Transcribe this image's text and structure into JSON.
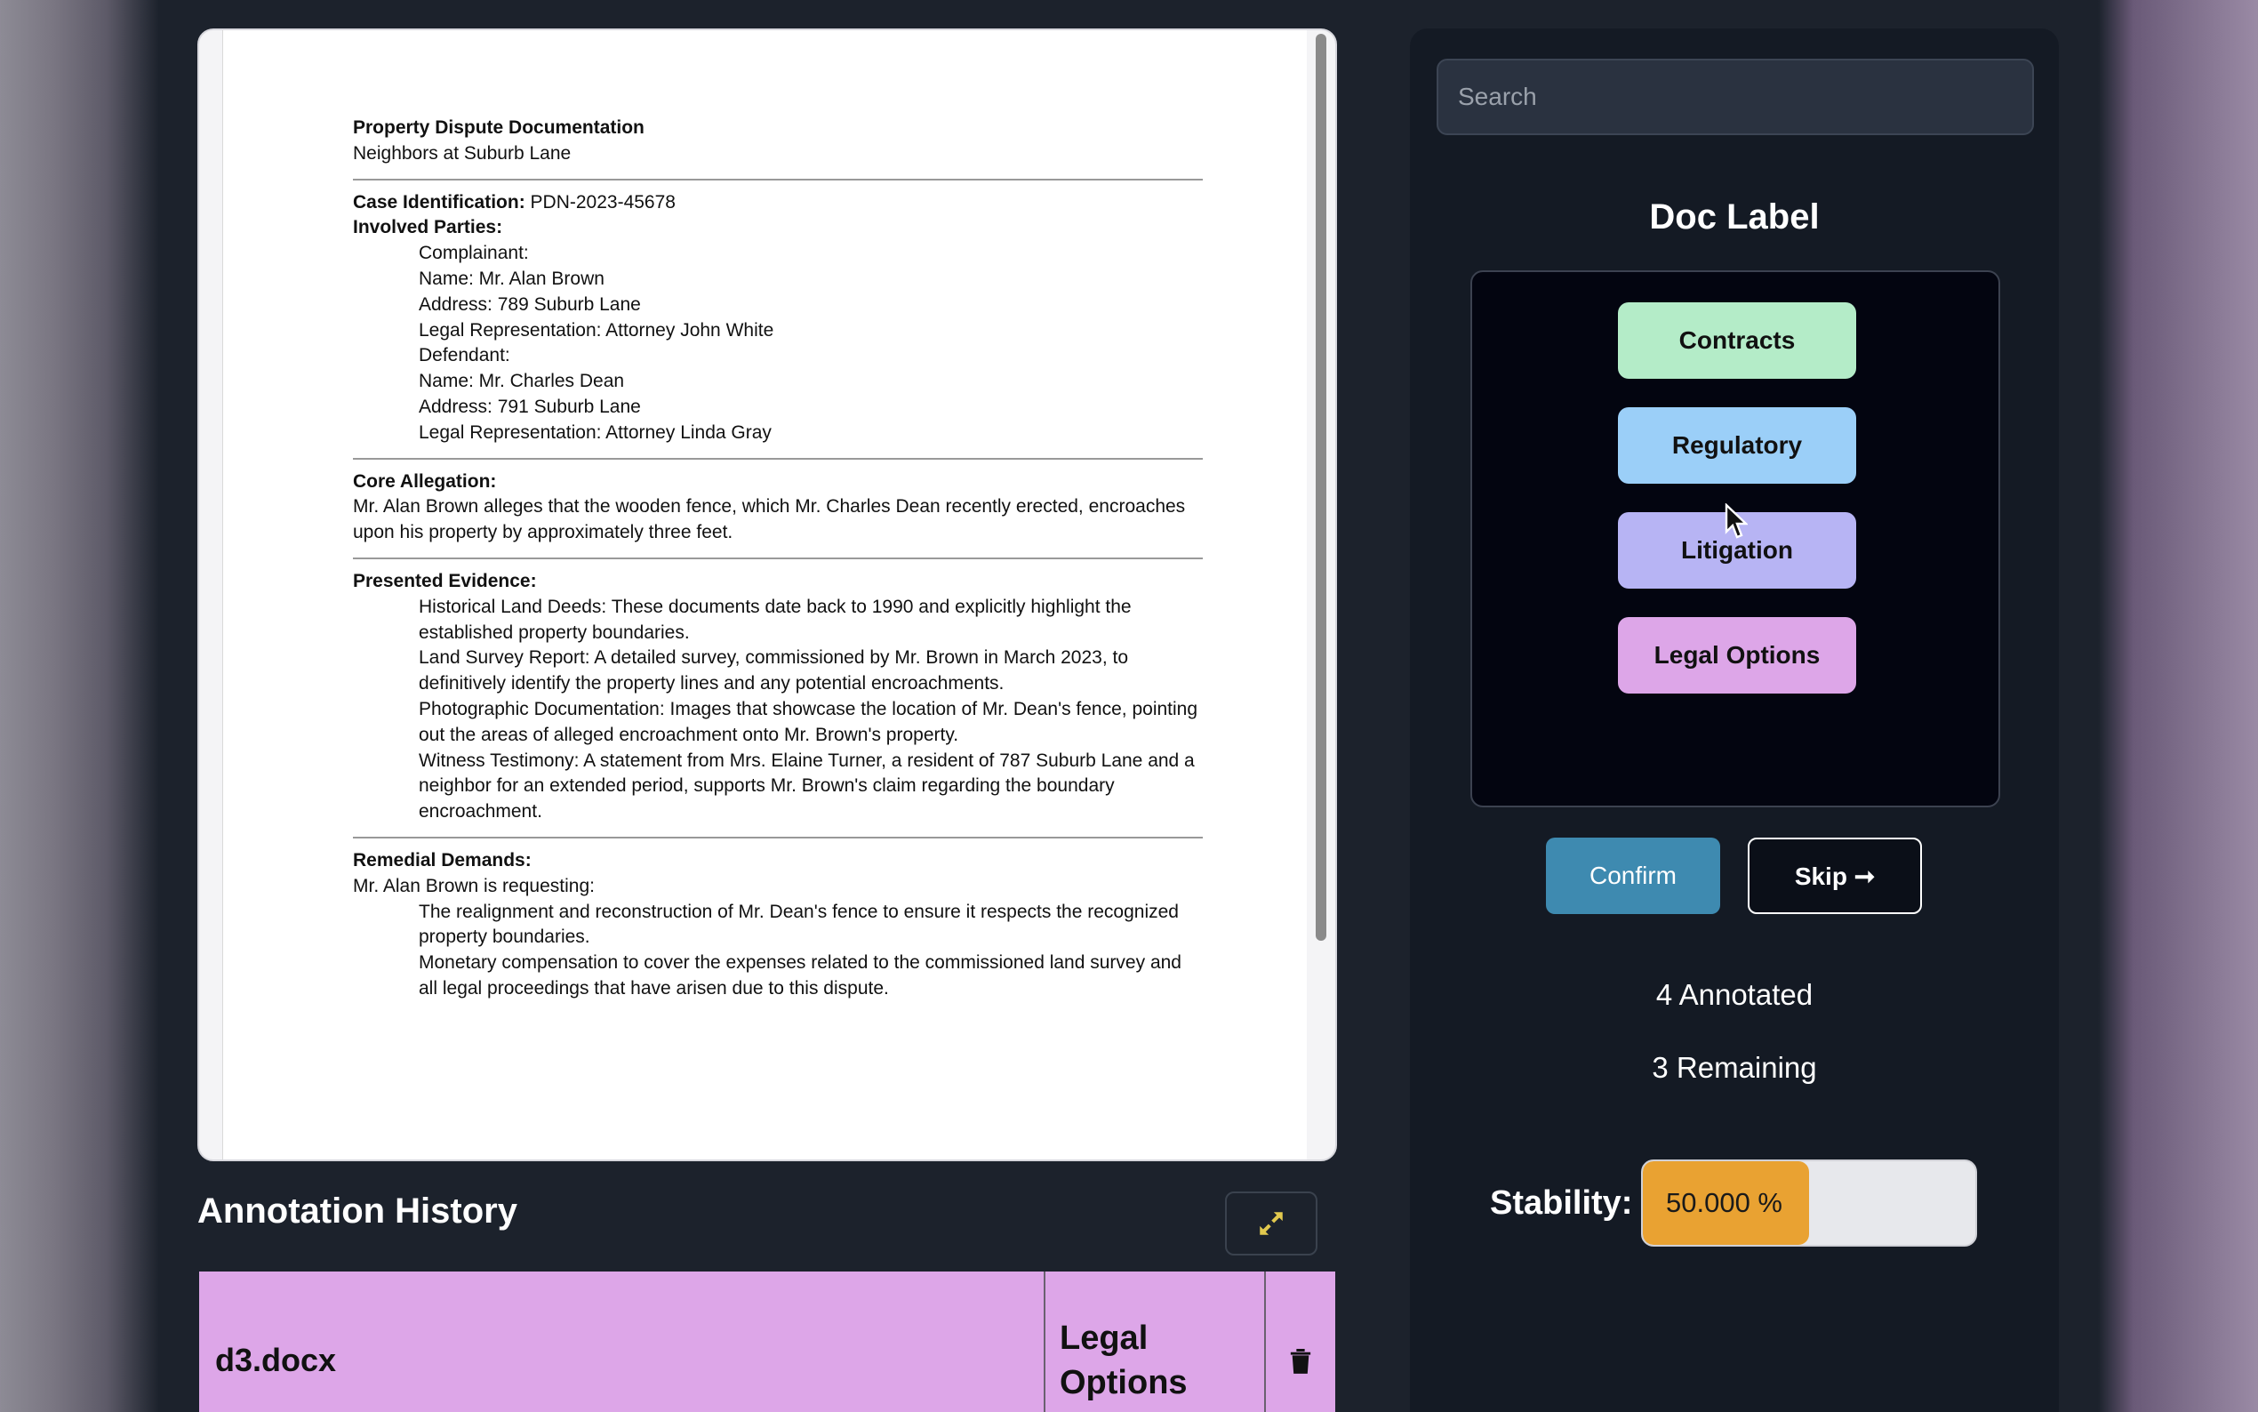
{
  "document": {
    "title": "Property Dispute Documentation",
    "subtitle": "Neighbors at Suburb Lane",
    "case_label": "Case Identification:",
    "case_value": " PDN-2023-45678",
    "parties_heading": "Involved Parties:",
    "parties": [
      "Complainant:",
      "Name: Mr. Alan Brown",
      "Address: 789 Suburb Lane",
      "Legal Representation: Attorney John White",
      "Defendant:",
      "Name: Mr. Charles Dean",
      "Address: 791 Suburb Lane",
      "Legal Representation: Attorney Linda Gray"
    ],
    "allegation_heading": "Core Allegation:",
    "allegation_text": "Mr. Alan Brown alleges that the wooden fence, which Mr. Charles Dean recently erected, encroaches upon his property by approximately three feet.",
    "evidence_heading": "Presented Evidence:",
    "evidence": [
      "Historical Land Deeds: These documents date back to 1990 and explicitly highlight the established property boundaries.",
      "Land Survey Report: A detailed survey, commissioned by Mr. Brown in March 2023, to definitively identify the property lines and any potential encroachments.",
      "Photographic Documentation: Images that showcase the location of Mr. Dean's fence, pointing out the areas of alleged encroachment onto Mr. Brown's property.",
      "Witness Testimony: A statement from Mrs. Elaine Turner, a resident of 787 Suburb Lane and a neighbor for an extended period, supports Mr. Brown's claim regarding the boundary encroachment."
    ],
    "demands_heading": "Remedial Demands:",
    "demands_intro": "Mr. Alan Brown is requesting:",
    "demands": [
      "The realignment and reconstruction of Mr. Dean's fence to ensure it respects the recognized property boundaries.",
      "Monetary compensation to cover the expenses related to the commissioned land survey and all legal proceedings that have arisen due to this dispute."
    ]
  },
  "history": {
    "title": "Annotation History",
    "expand_icon": "expand-arrows-icon",
    "rows": [
      {
        "file": "d3.docx",
        "label": "Legal Options",
        "color": "#dda6e8",
        "delete_icon": "trash-icon"
      }
    ]
  },
  "panel": {
    "search_placeholder": "Search",
    "doc_label_title": "Doc Label",
    "labels": [
      {
        "name": "Contracts",
        "color": "#b4ecc8"
      },
      {
        "name": "Regulatory",
        "color": "#9bcff8"
      },
      {
        "name": "Litigation",
        "color": "#b7b4f4"
      },
      {
        "name": "Legal Options",
        "color": "#dda6e8"
      }
    ],
    "confirm_label": "Confirm",
    "skip_label": "Skip ➞",
    "annotated": "4 Annotated",
    "remaining": "3 Remaining",
    "stability_label": "Stability:",
    "stability_value": "50.000 %",
    "stability_fraction": 0.5
  },
  "colors": {
    "accent": "#3e8ab0",
    "stability_fill": "#e9a232",
    "background": "#1c222c"
  }
}
